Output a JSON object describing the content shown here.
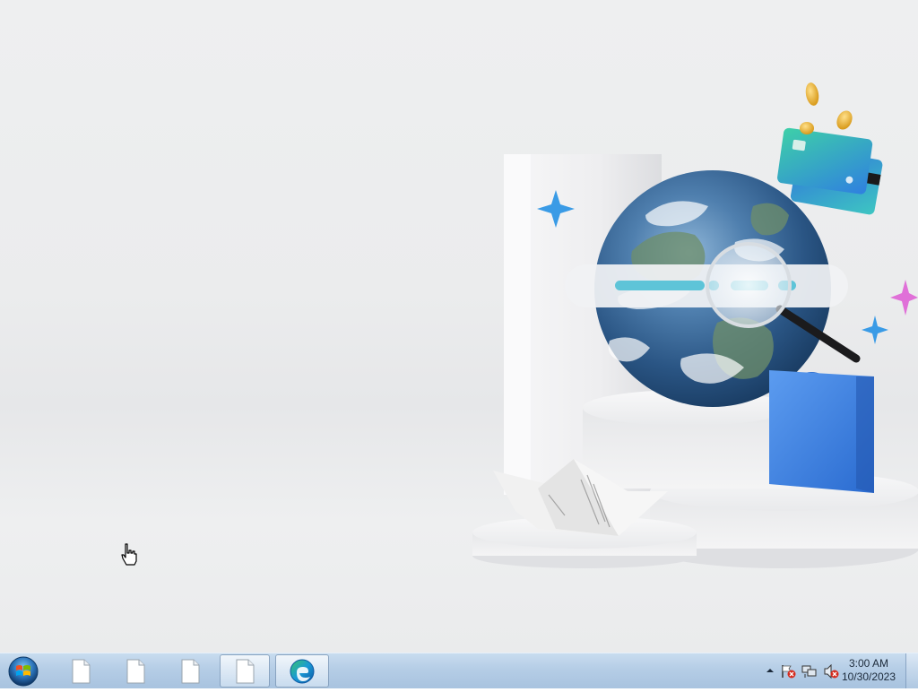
{
  "desktop": {
    "wallpaper": "windows-edge-globe-wallpaper"
  },
  "taskbar": {
    "start_icon": "windows-start-orb-icon",
    "pinned": [
      {
        "icon": "blank-document-icon"
      },
      {
        "icon": "blank-document-icon"
      },
      {
        "icon": "blank-document-icon"
      },
      {
        "icon": "blank-document-icon",
        "active": true
      },
      {
        "icon": "edge-browser-icon"
      }
    ],
    "tray": {
      "show_hidden_icon": "chevron-up-icon",
      "icons": [
        "action-center-flag-error-icon",
        "network-icon",
        "volume-muted-icon"
      ],
      "time": "3:00 AM",
      "date": "10/30/2023"
    }
  },
  "colors": {
    "taskbar": "#b5cde6",
    "edge_blue": "#0c59a4",
    "edge_green": "#3bc46a",
    "globe_ocean": "#2a5f95",
    "bag_blue": "#3b82e0"
  }
}
